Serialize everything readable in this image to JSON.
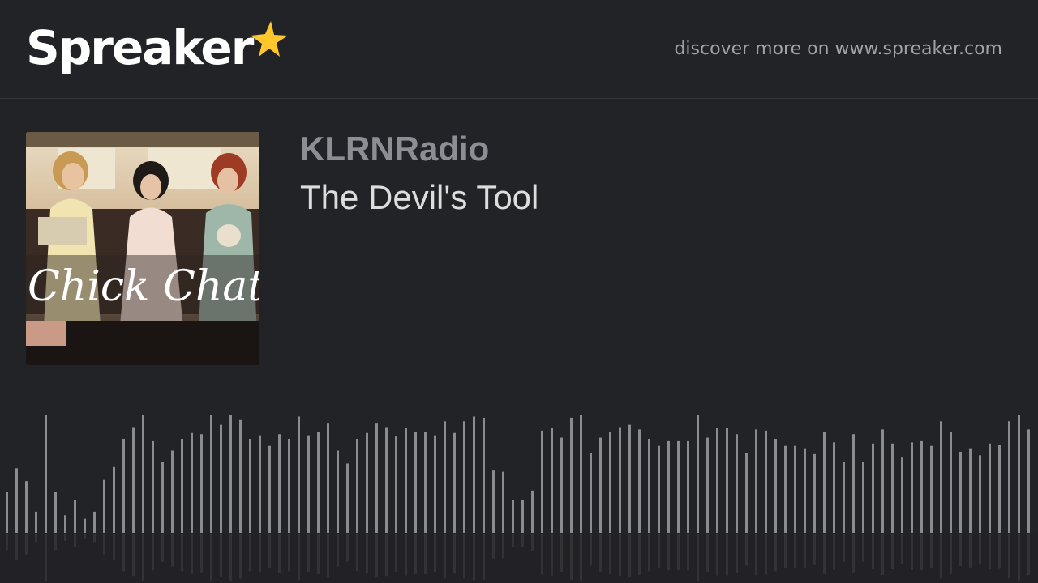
{
  "header": {
    "brand_name": "Spreaker",
    "brand_icon": "star-icon",
    "brand_color": "#ffc72c",
    "discover_text": "discover more on www.spreaker.com"
  },
  "podcast": {
    "show_name": "KLRNRadio",
    "episode_title": "The Devil's Tool",
    "cover_text": "Chick Chat"
  },
  "waveform": {
    "bar_color": "#8b8c90",
    "levels": [
      0.35,
      0.55,
      0.44,
      0.18,
      1.0,
      0.35,
      0.15,
      0.28,
      0.12,
      0.18,
      0.45,
      0.56,
      0.8,
      0.9,
      1.0,
      0.78,
      0.6,
      0.7,
      0.8,
      0.85,
      0.84,
      1.0,
      0.92,
      1.0,
      0.96,
      0.8,
      0.83,
      0.74,
      0.84,
      0.8,
      0.99,
      0.83,
      0.86,
      0.93,
      0.7,
      0.59,
      0.8,
      0.85,
      0.93,
      0.9,
      0.82,
      0.89,
      0.86,
      0.86,
      0.83,
      0.95,
      0.85,
      0.95,
      0.99,
      0.98,
      0.53,
      0.52,
      0.28,
      0.28,
      0.36,
      0.87,
      0.89,
      0.81,
      0.98,
      1.0,
      0.68,
      0.81,
      0.86,
      0.9,
      0.92,
      0.88,
      0.8,
      0.74,
      0.78,
      0.78,
      0.78,
      1.0,
      0.81,
      0.89,
      0.89,
      0.84,
      0.68,
      0.88,
      0.87,
      0.8,
      0.74,
      0.74,
      0.72,
      0.67,
      0.86,
      0.77,
      0.6,
      0.84,
      0.6,
      0.76,
      0.88,
      0.76,
      0.64,
      0.77,
      0.78,
      0.74,
      0.95,
      0.86,
      0.69,
      0.72,
      0.66,
      0.76,
      0.75,
      0.95,
      1.0,
      0.88,
      0.78,
      0.76,
      0.7
    ]
  }
}
